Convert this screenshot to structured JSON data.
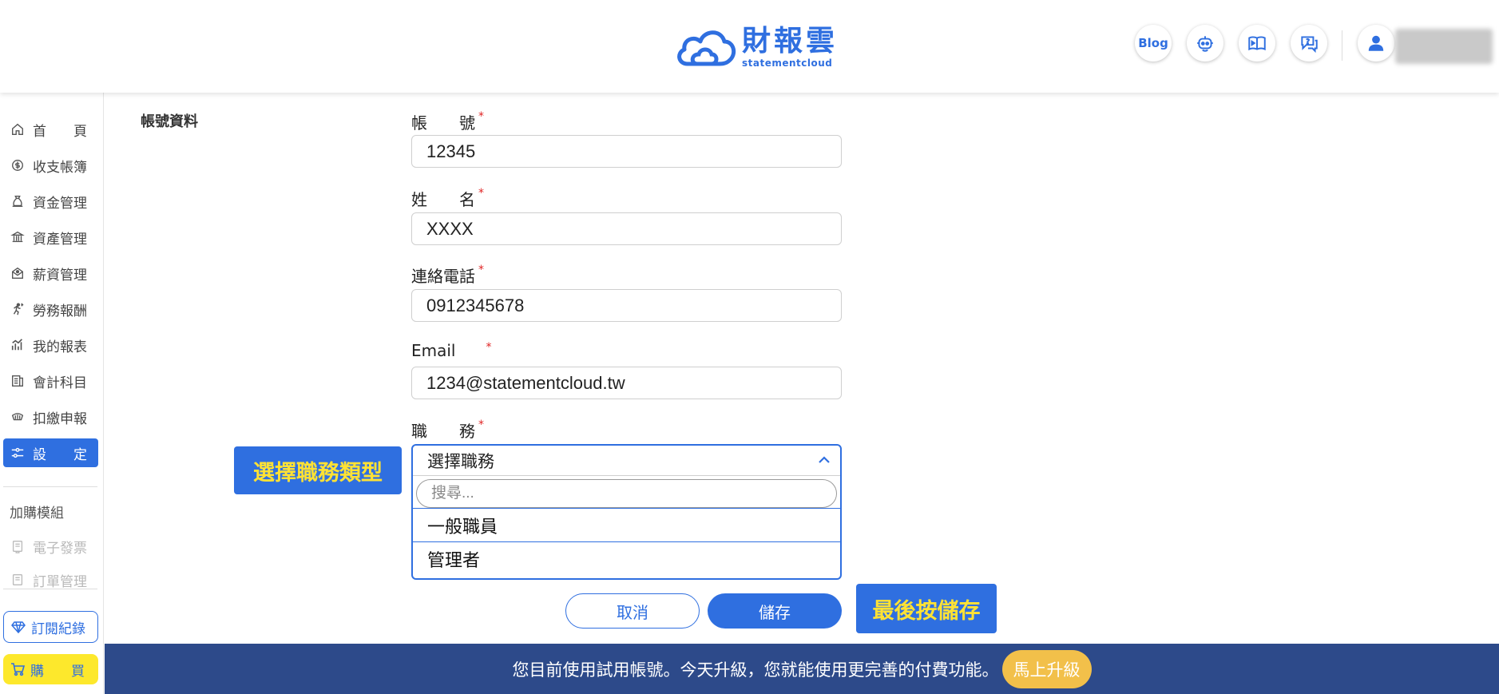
{
  "header": {
    "logo_cn": "財報雲",
    "logo_en": "statementcloud",
    "blog_label": "Blog",
    "brand_color": "#2f6fe0"
  },
  "sidebar": {
    "items": [
      {
        "label": "首　　頁",
        "icon": "home-icon"
      },
      {
        "label": "收支帳簿",
        "icon": "coin-icon"
      },
      {
        "label": "資金管理",
        "icon": "money-bag-icon"
      },
      {
        "label": "資產管理",
        "icon": "bank-icon"
      },
      {
        "label": "薪資管理",
        "icon": "payroll-icon"
      },
      {
        "label": "勞務報酬",
        "icon": "runner-icon"
      },
      {
        "label": "我的報表",
        "icon": "chart-icon"
      },
      {
        "label": "會計科目",
        "icon": "ledger-icon"
      },
      {
        "label": "扣繳申報",
        "icon": "stamp-icon"
      },
      {
        "label": "設　　定",
        "icon": "settings-sliders-icon"
      }
    ],
    "addon_title": "加購模組",
    "addons": [
      {
        "label": "電子發票",
        "icon": "invoice-icon"
      },
      {
        "label": "訂單管理",
        "icon": "order-icon"
      }
    ],
    "subscription_label": "訂閱紀錄",
    "buy_label": "購　　買"
  },
  "main": {
    "section_title": "帳號資料",
    "fields": [
      {
        "label": "帳　　號",
        "value": "12345"
      },
      {
        "label": "姓　　名",
        "value": "XXXX"
      },
      {
        "label": "連絡電話",
        "value": "0912345678"
      },
      {
        "label": "Email",
        "value": "1234@statementcloud.tw"
      }
    ],
    "required_mark": "*",
    "role": {
      "label": "職　　務",
      "selected": "選擇職務",
      "search_placeholder": "搜尋...",
      "options": [
        "一般職員",
        "管理者"
      ]
    },
    "cancel_label": "取消",
    "save_label": "儲存"
  },
  "callouts": {
    "role_hint": "選擇職務類型",
    "save_hint": "最後按儲存"
  },
  "banner": {
    "message": "您目前使用試用帳號。今天升級，您就能使用更完善的付費功能。",
    "upgrade_label": "馬上升級"
  }
}
